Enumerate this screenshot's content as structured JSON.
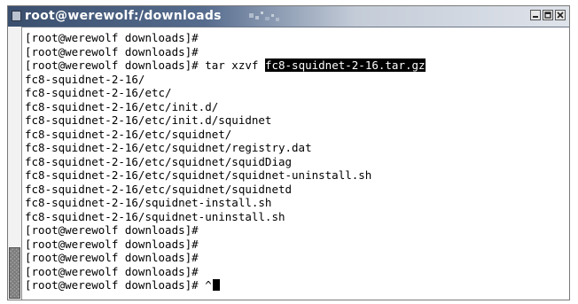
{
  "window": {
    "title": "root@werewolf:/downloads"
  },
  "terminal": {
    "lines": [
      "[root@werewolf downloads]#",
      "[root@werewolf downloads]#",
      "[root@werewolf downloads]# tar xzvf ",
      "fc8-squidnet-2-16/",
      "fc8-squidnet-2-16/etc/",
      "fc8-squidnet-2-16/etc/init.d/",
      "fc8-squidnet-2-16/etc/init.d/squidnet",
      "fc8-squidnet-2-16/etc/squidnet/",
      "fc8-squidnet-2-16/etc/squidnet/registry.dat",
      "fc8-squidnet-2-16/etc/squidnet/squidDiag",
      "fc8-squidnet-2-16/etc/squidnet/squidnet-uninstall.sh",
      "fc8-squidnet-2-16/etc/squidnet/squidnetd",
      "fc8-squidnet-2-16/squidnet-install.sh",
      "fc8-squidnet-2-16/squidnet-uninstall.sh",
      "[root@werewolf downloads]#",
      "[root@werewolf downloads]#",
      "[root@werewolf downloads]#",
      "[root@werewolf downloads]#",
      "[root@werewolf downloads]# ^"
    ],
    "selected_text": "fc8-squidnet-2-16.tar.gz"
  },
  "icons": {
    "window_icon": "window-menu-icon",
    "minimize": "minimize-icon",
    "maximize": "maximize-icon",
    "close": "close-icon"
  }
}
